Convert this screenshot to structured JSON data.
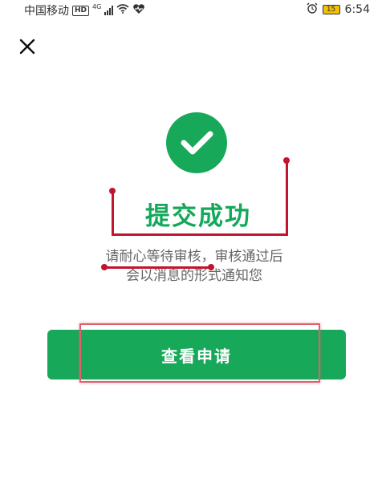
{
  "status_bar": {
    "carrier": "中国移动",
    "hd": "HD",
    "network": "4G",
    "battery": "15",
    "time": "6:54"
  },
  "success": {
    "title": "提交成功",
    "desc_line1": "请耐心等待审核，审核通过后",
    "desc_line2": "会以消息的形式通知您"
  },
  "action_button": {
    "label": "查看申请"
  },
  "colors": {
    "primary_green": "#17a85a",
    "annotation_red": "#c0142f"
  }
}
